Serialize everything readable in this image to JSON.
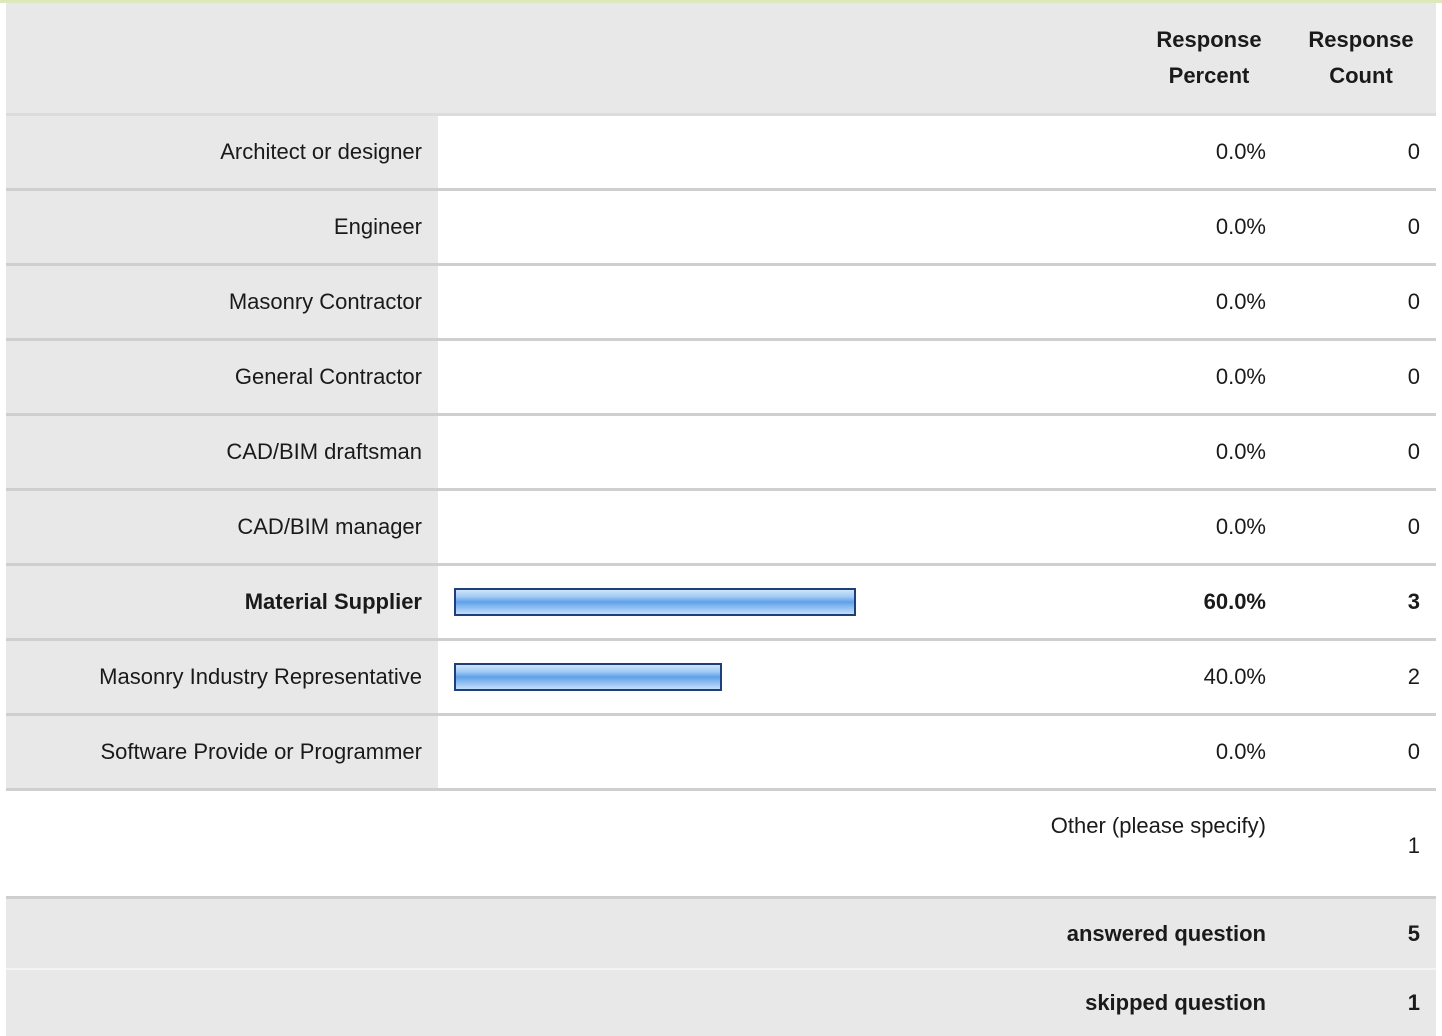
{
  "header": {
    "percent_line1": "Response",
    "percent_line2": "Percent",
    "count_line1": "Response",
    "count_line2": "Count"
  },
  "rows": [
    {
      "label": "Architect or designer",
      "percent": "0.0%",
      "count": "0",
      "fraction": 0.0,
      "bold": false
    },
    {
      "label": "Engineer",
      "percent": "0.0%",
      "count": "0",
      "fraction": 0.0,
      "bold": false
    },
    {
      "label": "Masonry Contractor",
      "percent": "0.0%",
      "count": "0",
      "fraction": 0.0,
      "bold": false
    },
    {
      "label": "General Contractor",
      "percent": "0.0%",
      "count": "0",
      "fraction": 0.0,
      "bold": false
    },
    {
      "label": "CAD/BIM draftsman",
      "percent": "0.0%",
      "count": "0",
      "fraction": 0.0,
      "bold": false
    },
    {
      "label": "CAD/BIM manager",
      "percent": "0.0%",
      "count": "0",
      "fraction": 0.0,
      "bold": false
    },
    {
      "label": "Material Supplier",
      "percent": "60.0%",
      "count": "3",
      "fraction": 0.6,
      "bold": true
    },
    {
      "label": "Masonry Industry Representative",
      "percent": "40.0%",
      "count": "2",
      "fraction": 0.4,
      "bold": false
    },
    {
      "label": "Software Provide or Programmer",
      "percent": "0.0%",
      "count": "0",
      "fraction": 0.0,
      "bold": false
    }
  ],
  "other": {
    "label": "Other (please specify)",
    "count": "1"
  },
  "summary": {
    "answered_label": "answered question",
    "answered_value": "5",
    "skipped_label": "skipped question",
    "skipped_value": "1"
  },
  "colors": {
    "bar_fill": "#5fa0e8",
    "bar_border": "#1f3f7a",
    "label_bg": "#e8e8e8"
  }
}
